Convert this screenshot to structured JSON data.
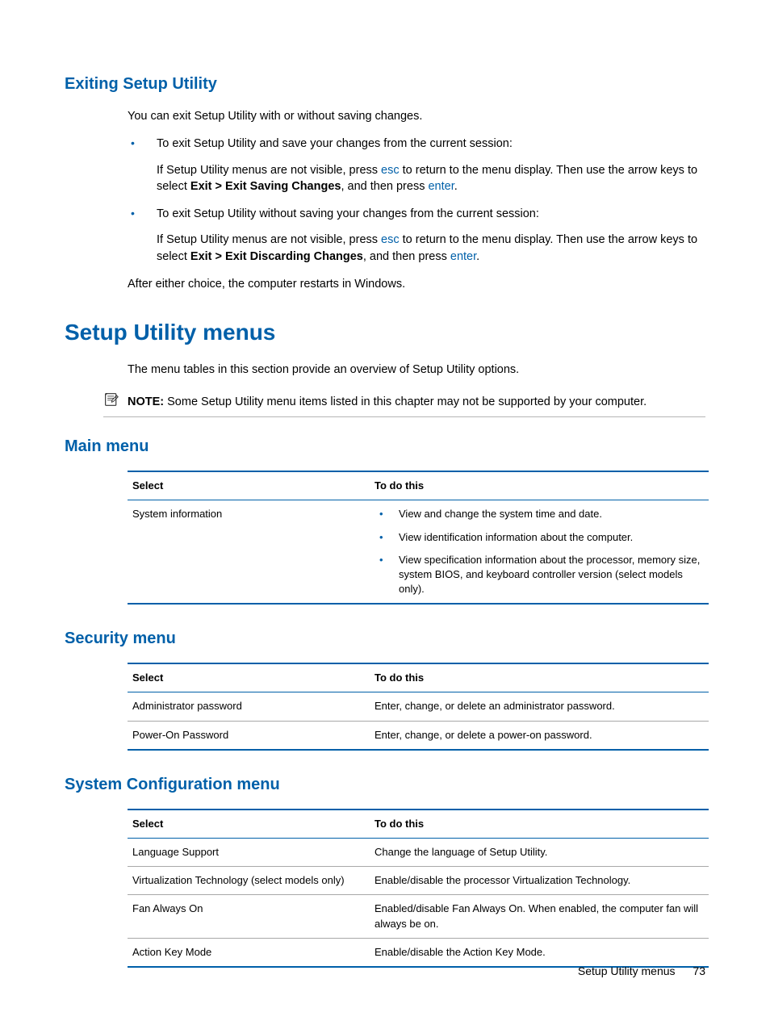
{
  "section1": {
    "heading": "Exiting Setup Utility",
    "intro": "You can exit Setup Utility with or without saving changes.",
    "bullets": [
      {
        "line": "To exit Setup Utility and save your changes from the current session:",
        "sub_pre": "If Setup Utility menus are not visible, press ",
        "sub_key1": "esc",
        "sub_mid": " to return to the menu display. Then use the arrow keys to select ",
        "sub_bold": "Exit > Exit Saving Changes",
        "sub_post": ", and then press ",
        "sub_key2": "enter",
        "sub_end": "."
      },
      {
        "line": "To exit Setup Utility without saving your changes from the current session:",
        "sub_pre": "If Setup Utility menus are not visible, press ",
        "sub_key1": "esc",
        "sub_mid": " to return to the menu display. Then use the arrow keys to select ",
        "sub_bold": "Exit > Exit Discarding Changes",
        "sub_post": ", and then press ",
        "sub_key2": "enter",
        "sub_end": "."
      }
    ],
    "outro": "After either choice, the computer restarts in Windows."
  },
  "section2": {
    "heading": "Setup Utility menus",
    "intro": "The menu tables in this section provide an overview of Setup Utility options.",
    "note_label": "NOTE:",
    "note_text": "Some Setup Utility menu items listed in this chapter may not be supported by your computer."
  },
  "main_menu": {
    "heading": "Main menu",
    "th_select": "Select",
    "th_todo": "To do this",
    "row_select": "System information",
    "items": [
      "View and change the system time and date.",
      "View identification information about the computer.",
      "View specification information about the processor, memory size, system BIOS, and keyboard controller version (select models only)."
    ]
  },
  "security_menu": {
    "heading": "Security menu",
    "th_select": "Select",
    "th_todo": "To do this",
    "rows": [
      {
        "select": "Administrator password",
        "todo": "Enter, change, or delete an administrator password."
      },
      {
        "select": "Power-On Password",
        "todo": "Enter, change, or delete a power-on password."
      }
    ]
  },
  "sysconfig_menu": {
    "heading": "System Configuration menu",
    "th_select": "Select",
    "th_todo": "To do this",
    "rows": [
      {
        "select": "Language Support",
        "todo": "Change the language of Setup Utility."
      },
      {
        "select": "Virtualization Technology (select models only)",
        "todo": "Enable/disable the processor Virtualization Technology."
      },
      {
        "select": "Fan Always On",
        "todo": "Enabled/disable Fan Always On. When enabled, the computer fan will always be on."
      },
      {
        "select": "Action Key Mode",
        "todo": "Enable/disable the Action Key Mode."
      }
    ]
  },
  "footer": {
    "title": "Setup Utility menus",
    "page": "73"
  }
}
